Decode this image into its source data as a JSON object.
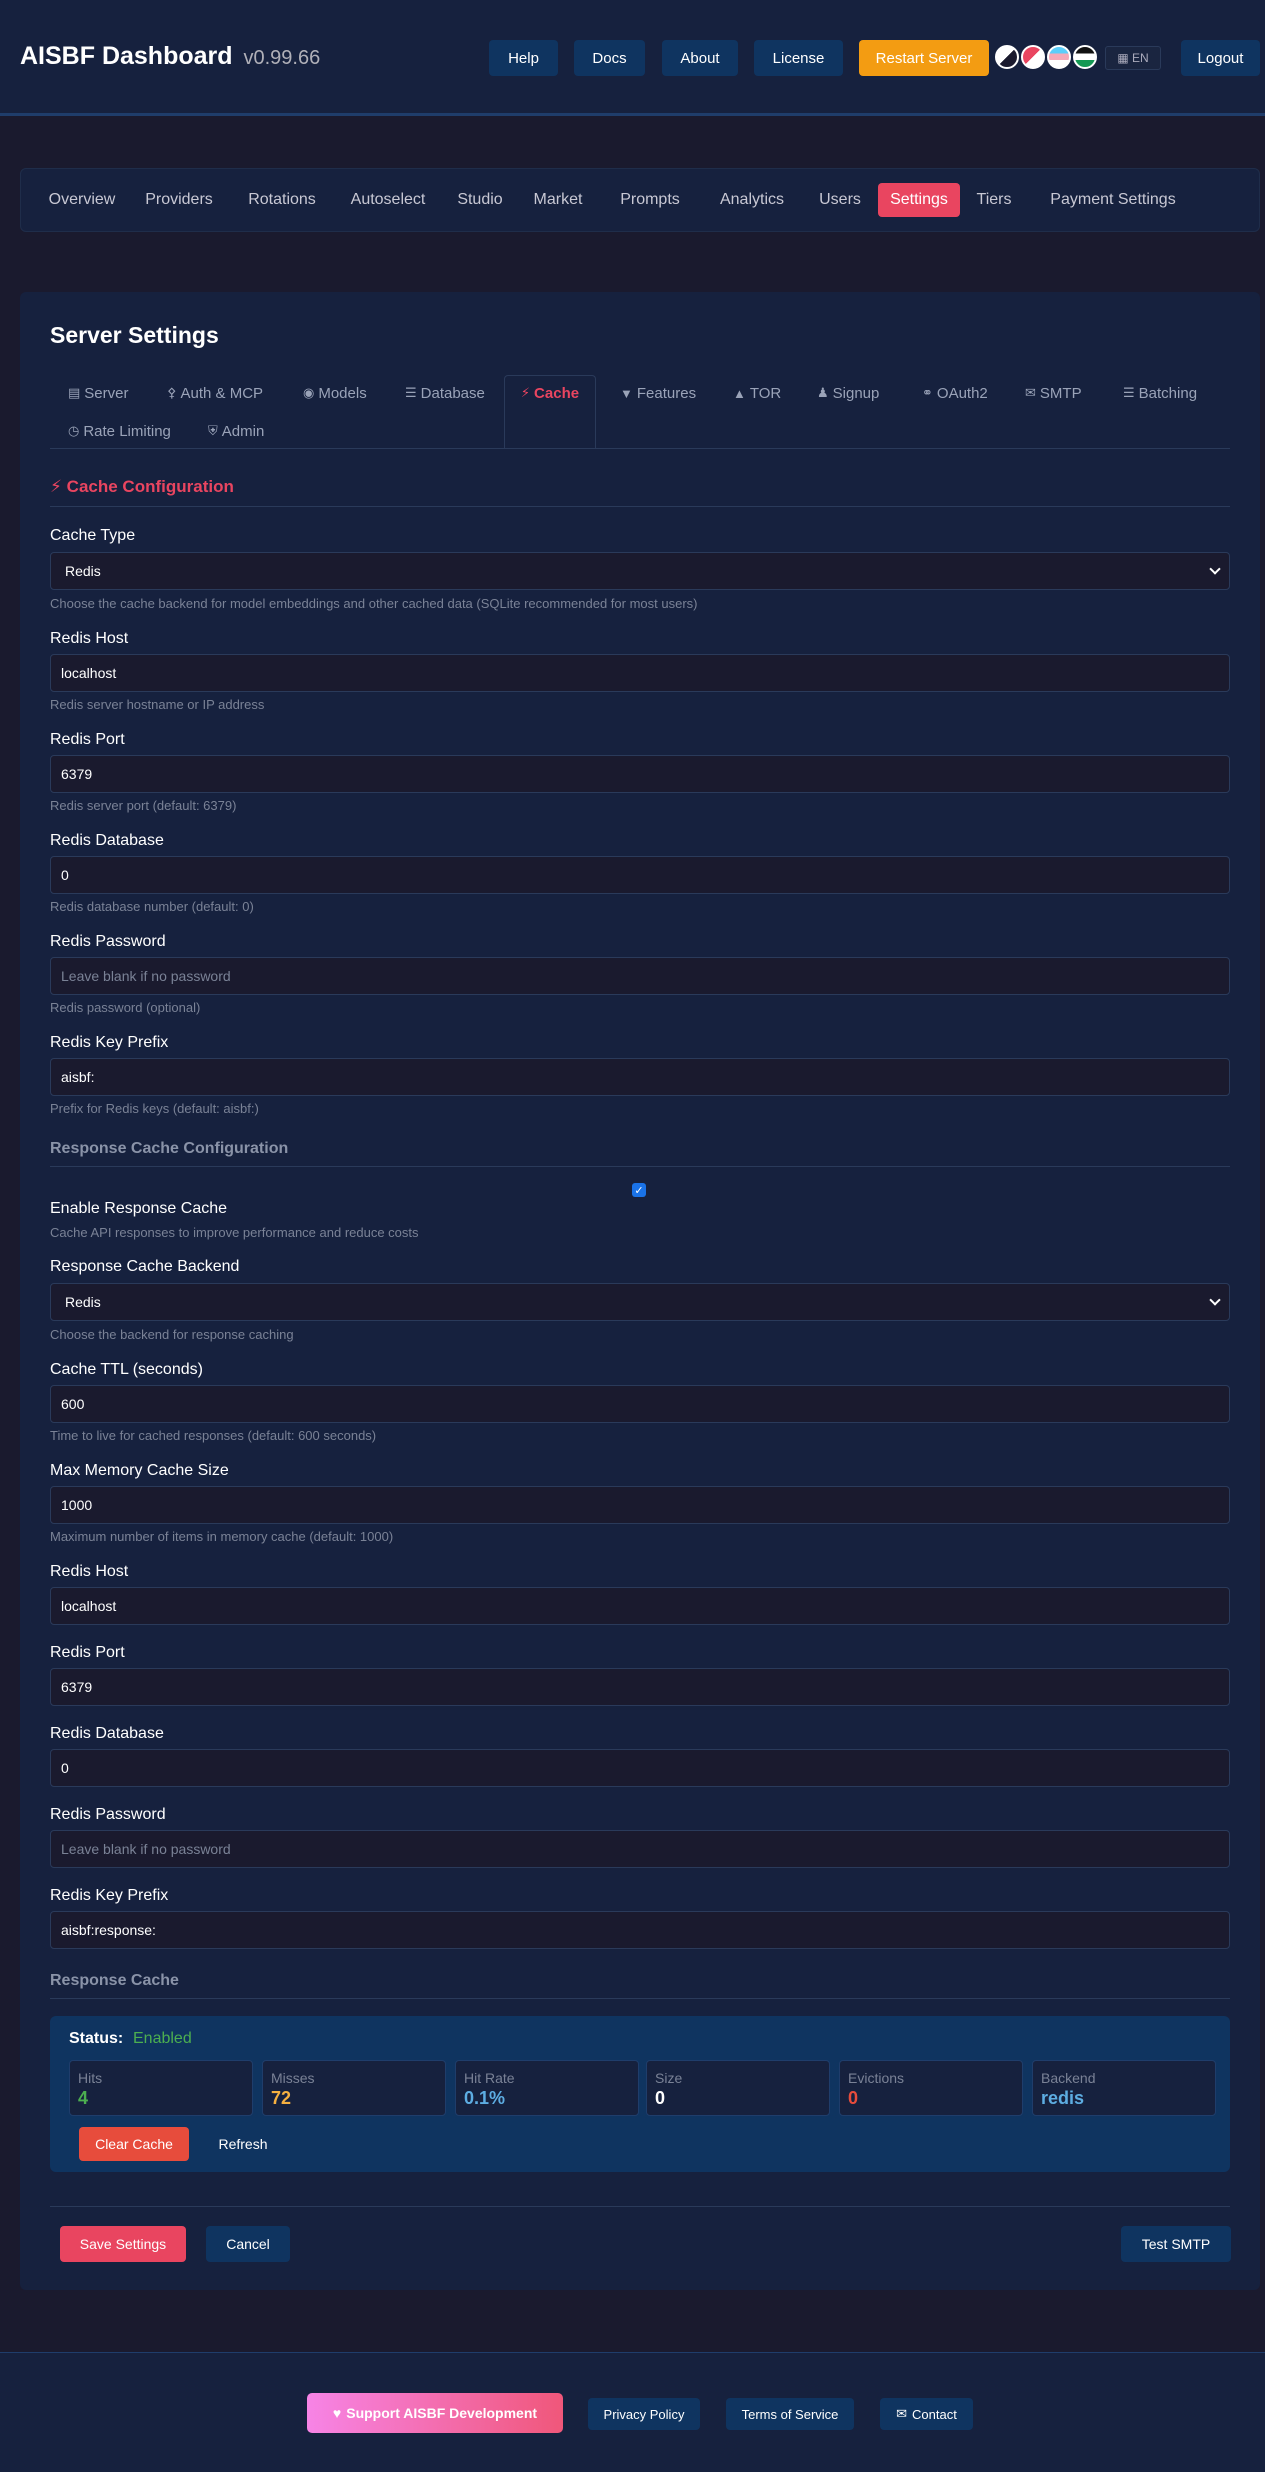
{
  "header": {
    "title": "AISBF Dashboard",
    "version": "v0.99.66",
    "buttons": {
      "help": "Help",
      "docs": "Docs",
      "about": "About",
      "license": "License",
      "restart": "Restart Server",
      "logout": "Logout"
    },
    "lang": "EN"
  },
  "nav": {
    "items": [
      "Overview",
      "Providers",
      "Rotations",
      "Autoselect",
      "Studio",
      "Market",
      "Prompts",
      "Analytics",
      "Users",
      "Settings",
      "Tiers",
      "Payment Settings"
    ],
    "active": "Settings"
  },
  "page": {
    "title": "Server Settings",
    "tabs": [
      "Server",
      "Auth & MCP",
      "Models",
      "Database",
      "Cache",
      "Features",
      "TOR",
      "Signup",
      "OAuth2",
      "SMTP",
      "Batching",
      "Rate Limiting",
      "Admin"
    ],
    "active_tab": "Cache"
  },
  "cache_config": {
    "heading": "Cache Configuration",
    "cache_type": {
      "label": "Cache Type",
      "value": "Redis",
      "help": "Choose the cache backend for model embeddings and other cached data (SQLite recommended for most users)"
    },
    "redis_host": {
      "label": "Redis Host",
      "value": "localhost",
      "help": "Redis server hostname or IP address"
    },
    "redis_port": {
      "label": "Redis Port",
      "value": "6379",
      "help": "Redis server port (default: 6379)"
    },
    "redis_db": {
      "label": "Redis Database",
      "value": "0",
      "help": "Redis database number (default: 0)"
    },
    "redis_password": {
      "label": "Redis Password",
      "placeholder": "Leave blank if no password",
      "help": "Redis password (optional)"
    },
    "redis_prefix": {
      "label": "Redis Key Prefix",
      "value": "aisbf:",
      "help": "Prefix for Redis keys (default: aisbf:)"
    }
  },
  "response_cache": {
    "heading": "Response Cache Configuration",
    "enable": {
      "label": "Enable Response Cache",
      "checked": true,
      "help": "Cache API responses to improve performance and reduce costs"
    },
    "backend": {
      "label": "Response Cache Backend",
      "value": "Redis",
      "help": "Choose the backend for response caching"
    },
    "ttl": {
      "label": "Cache TTL (seconds)",
      "value": "600",
      "help": "Time to live for cached responses (default: 600 seconds)"
    },
    "max_mem": {
      "label": "Max Memory Cache Size",
      "value": "1000",
      "help": "Maximum number of items in memory cache (default: 1000)"
    },
    "redis_host": {
      "label": "Redis Host",
      "value": "localhost"
    },
    "redis_port": {
      "label": "Redis Port",
      "value": "6379"
    },
    "redis_db": {
      "label": "Redis Database",
      "value": "0"
    },
    "redis_password": {
      "label": "Redis Password",
      "placeholder": "Leave blank if no password"
    },
    "redis_prefix": {
      "label": "Redis Key Prefix",
      "value": "aisbf:response:"
    }
  },
  "stats": {
    "heading": "Response Cache",
    "status_label": "Status:",
    "status_value": "Enabled",
    "items": [
      {
        "label": "Hits",
        "value": "4",
        "color": "#4caf50"
      },
      {
        "label": "Misses",
        "value": "72",
        "color": "#f5b041"
      },
      {
        "label": "Hit Rate",
        "value": "0.1%",
        "color": "#5dade2"
      },
      {
        "label": "Size",
        "value": "0",
        "color": "#ffffff"
      },
      {
        "label": "Evictions",
        "value": "0",
        "color": "#e74c3c"
      },
      {
        "label": "Backend",
        "value": "redis",
        "color": "#5dade2"
      }
    ],
    "clear": "Clear Cache",
    "refresh": "Refresh"
  },
  "actions": {
    "save": "Save Settings",
    "cancel": "Cancel",
    "test_smtp": "Test SMTP"
  },
  "footer": {
    "support": "Support AISBF Development",
    "privacy": "Privacy Policy",
    "terms": "Terms of Service",
    "contact": "Contact"
  }
}
